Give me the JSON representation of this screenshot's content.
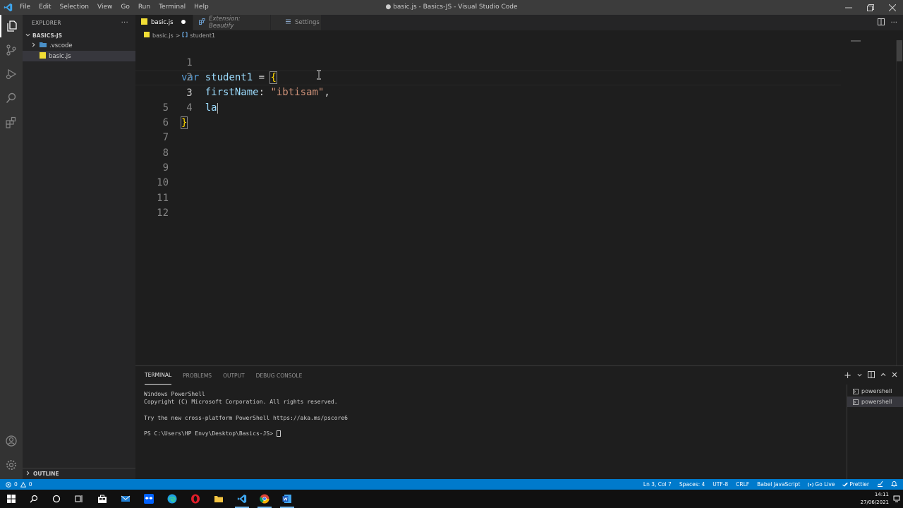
{
  "window": {
    "title": "● basic.js - Basics-JS - Visual Studio Code",
    "menu": [
      "File",
      "Edit",
      "Selection",
      "View",
      "Go",
      "Run",
      "Terminal",
      "Help"
    ]
  },
  "sidebar": {
    "header": "EXPLORER",
    "more": "···",
    "folder": "BASICS-JS",
    "items": [
      {
        "label": ".vscode",
        "icon": "folder-icon",
        "expanded": false
      },
      {
        "label": "basic.js",
        "icon": "js-file-icon",
        "selected": true
      }
    ],
    "outline": "OUTLINE"
  },
  "tabs": [
    {
      "label": "basic.js",
      "icon": "js-file-icon",
      "active": true,
      "dirty": true
    },
    {
      "label": "Extension: Beautify",
      "icon": "extension-icon",
      "italic": true
    },
    {
      "label": "Settings",
      "icon": "settings-icon"
    }
  ],
  "breadcrumb": {
    "file": "basic.js",
    "separator": ">",
    "symbol": "student1"
  },
  "editor": {
    "line_numbers": [
      "1",
      "2",
      "3",
      "4",
      "5",
      "6",
      "7",
      "8",
      "9",
      "10",
      "11",
      "12"
    ],
    "current_line": 3,
    "l1": {
      "kw": "var",
      "name": "student1",
      "op": "=",
      "brace": "{"
    },
    "l2": {
      "key": "firstName",
      "colon": ":",
      "str": "\"ibtisam\"",
      "comma": ","
    },
    "l3": {
      "text": "la"
    },
    "l4": {
      "brace": "}"
    }
  },
  "panel": {
    "tabs": [
      "TERMINAL",
      "PROBLEMS",
      "OUTPUT",
      "DEBUG CONSOLE"
    ],
    "terminal_lines": [
      "Windows PowerShell",
      "Copyright (C) Microsoft Corporation. All rights reserved.",
      "",
      "Try the new cross-platform PowerShell https://aka.ms/pscore6",
      ""
    ],
    "prompt": "PS C:\\Users\\HP Envy\\Desktop\\Basics-JS> ",
    "terminals": [
      "powershell",
      "powershell"
    ]
  },
  "statusbar": {
    "errors": "0",
    "warnings": "0",
    "position": "Ln 3, Col 7",
    "spaces": "Spaces: 4",
    "encoding": "UTF-8",
    "eol": "CRLF",
    "language": "Babel JavaScript",
    "golive": "Go Live",
    "prettier": "Prettier"
  },
  "taskbar": {
    "time": "14:11",
    "date": "27/06/2021"
  },
  "colors": {
    "statusbar": "#007acc",
    "keyword": "#569cd6",
    "variable": "#9cdcfe",
    "string": "#ce9178",
    "bracket": "#ffd700"
  }
}
